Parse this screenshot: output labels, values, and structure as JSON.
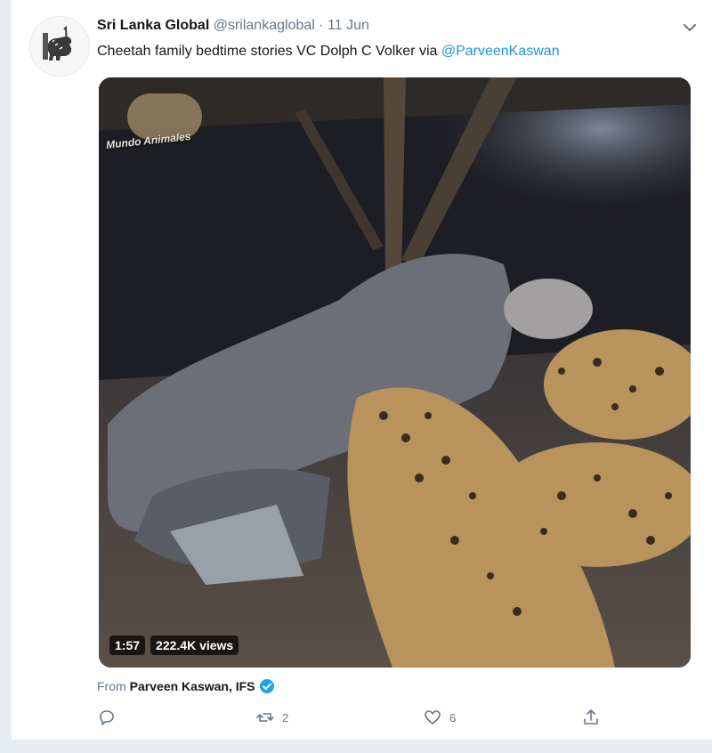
{
  "tweet": {
    "display_name": "Sri Lanka Global",
    "handle": "@srilankaglobal",
    "separator": "·",
    "date": "11 Jun",
    "text_prefix": "Cheetah family bedtime stories VC Dolph C Volker via ",
    "mention": "@ParveenKaswan",
    "avatar_icon": "sri-lanka-lion-flag-icon",
    "more_icon": "chevron-down-icon"
  },
  "media": {
    "watermark": "Mundo Animales",
    "duration": "1:57",
    "views": "222.4K views"
  },
  "source": {
    "from_label": "From",
    "from_name": "Parveen Kaswan, IFS",
    "verified_color": "#1da1f2"
  },
  "actions": {
    "reply_icon": "reply-icon",
    "retweet_icon": "retweet-icon",
    "retweet_count": "2",
    "like_icon": "heart-icon",
    "like_count": "6",
    "share_icon": "share-icon",
    "icon_color": "#657786"
  }
}
